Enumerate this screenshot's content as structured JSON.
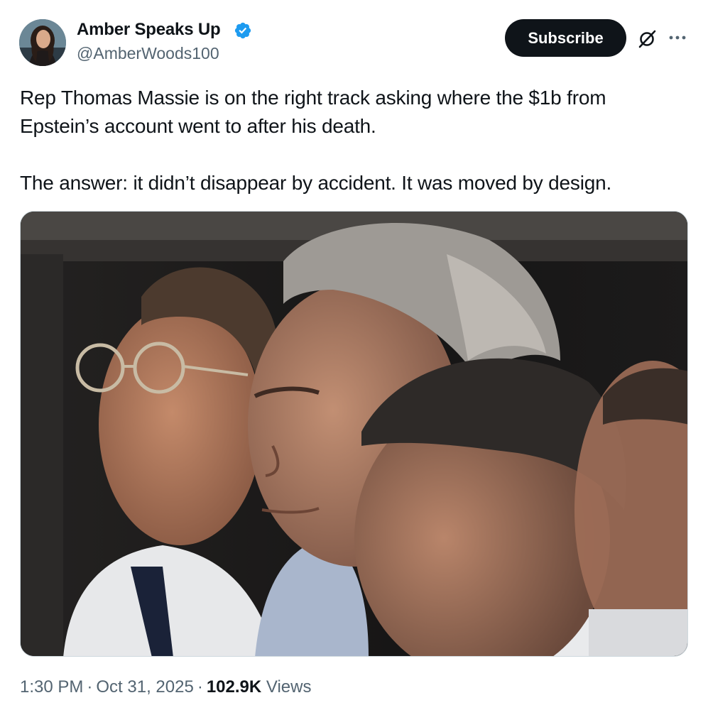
{
  "author": {
    "display_name": "Amber Speaks Up",
    "handle": "@AmberWoods100",
    "verified": true,
    "avatar_icon": "profile-photo"
  },
  "actions": {
    "subscribe_label": "Subscribe",
    "grok_icon": "grok-icon",
    "more_icon": "more-icon"
  },
  "tweet": {
    "paragraph_1": "Rep Thomas Massie is on the right track asking where the $1b from Epstein’s account went to after his death.",
    "paragraph_2": "The answer: it didn’t disappear by accident. It was moved by design."
  },
  "meta": {
    "time": "1:30 PM",
    "separator": "·",
    "date": "Oct 31, 2025",
    "views_count": "102.9K",
    "views_label": "Views"
  },
  "colors": {
    "text": "#0f1419",
    "secondary_text": "#536471",
    "verified_badge": "#1d9bf0",
    "subscribe_bg": "#0f1419"
  }
}
